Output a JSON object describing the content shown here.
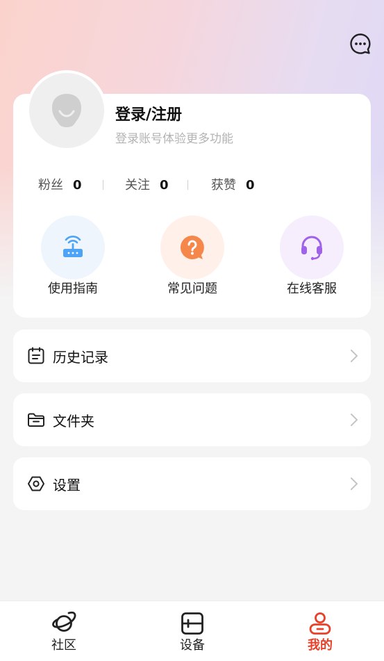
{
  "header": {
    "message_icon": "chat-bubble-icon"
  },
  "profile": {
    "avatar_icon": "default-avatar-icon",
    "title": "登录/注册",
    "subtitle": "登录账号体验更多功能"
  },
  "stats": [
    {
      "label": "粉丝",
      "value": "0"
    },
    {
      "label": "关注",
      "value": "0"
    },
    {
      "label": "获赞",
      "value": "0"
    }
  ],
  "quick_actions": [
    {
      "label": "使用指南",
      "icon": "router-icon",
      "color": "#4da3f5"
    },
    {
      "label": "常见问题",
      "icon": "question-bubble-icon",
      "color": "#f5874a"
    },
    {
      "label": "在线客服",
      "icon": "headset-icon",
      "color": "#a063e8"
    }
  ],
  "menu": [
    {
      "label": "历史记录",
      "icon": "history-list-icon"
    },
    {
      "label": "文件夹",
      "icon": "folder-icon"
    },
    {
      "label": "设置",
      "icon": "settings-hexagon-icon"
    }
  ],
  "tabbar": [
    {
      "label": "社区",
      "icon": "planet-icon",
      "active": false
    },
    {
      "label": "设备",
      "icon": "device-icon",
      "active": false
    },
    {
      "label": "我的",
      "icon": "user-icon",
      "active": true
    }
  ],
  "colors": {
    "accent": "#e8402a",
    "background": "#f4f4f4"
  }
}
